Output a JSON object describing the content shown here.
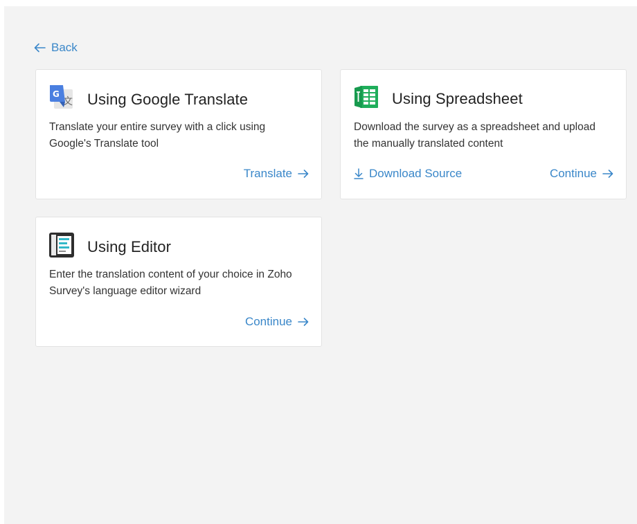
{
  "back": {
    "label": "Back",
    "icon": "arrow-left-icon"
  },
  "cards": [
    {
      "title": "Using Google Translate",
      "icon": "google-translate-icon",
      "description": "Translate your entire survey with a click using Google's Translate tool",
      "action": "Translate"
    },
    {
      "title": "Using Spreadsheet",
      "icon": "spreadsheet-icon",
      "description": "Download the survey as a spreadsheet and upload the manually translated content",
      "secondary_action": "Download Source",
      "action": "Continue"
    },
    {
      "title": "Using Editor",
      "icon": "editor-icon",
      "description": "Enter the translation content of your choice in Zoho Survey's language editor wizard",
      "action": "Continue"
    }
  ],
  "colors": {
    "accent": "#3a87c9",
    "background": "#f3f3f3",
    "card": "#ffffff",
    "spreadsheet_green": "#1fae5b",
    "google_blue": "#4a7fe0"
  }
}
